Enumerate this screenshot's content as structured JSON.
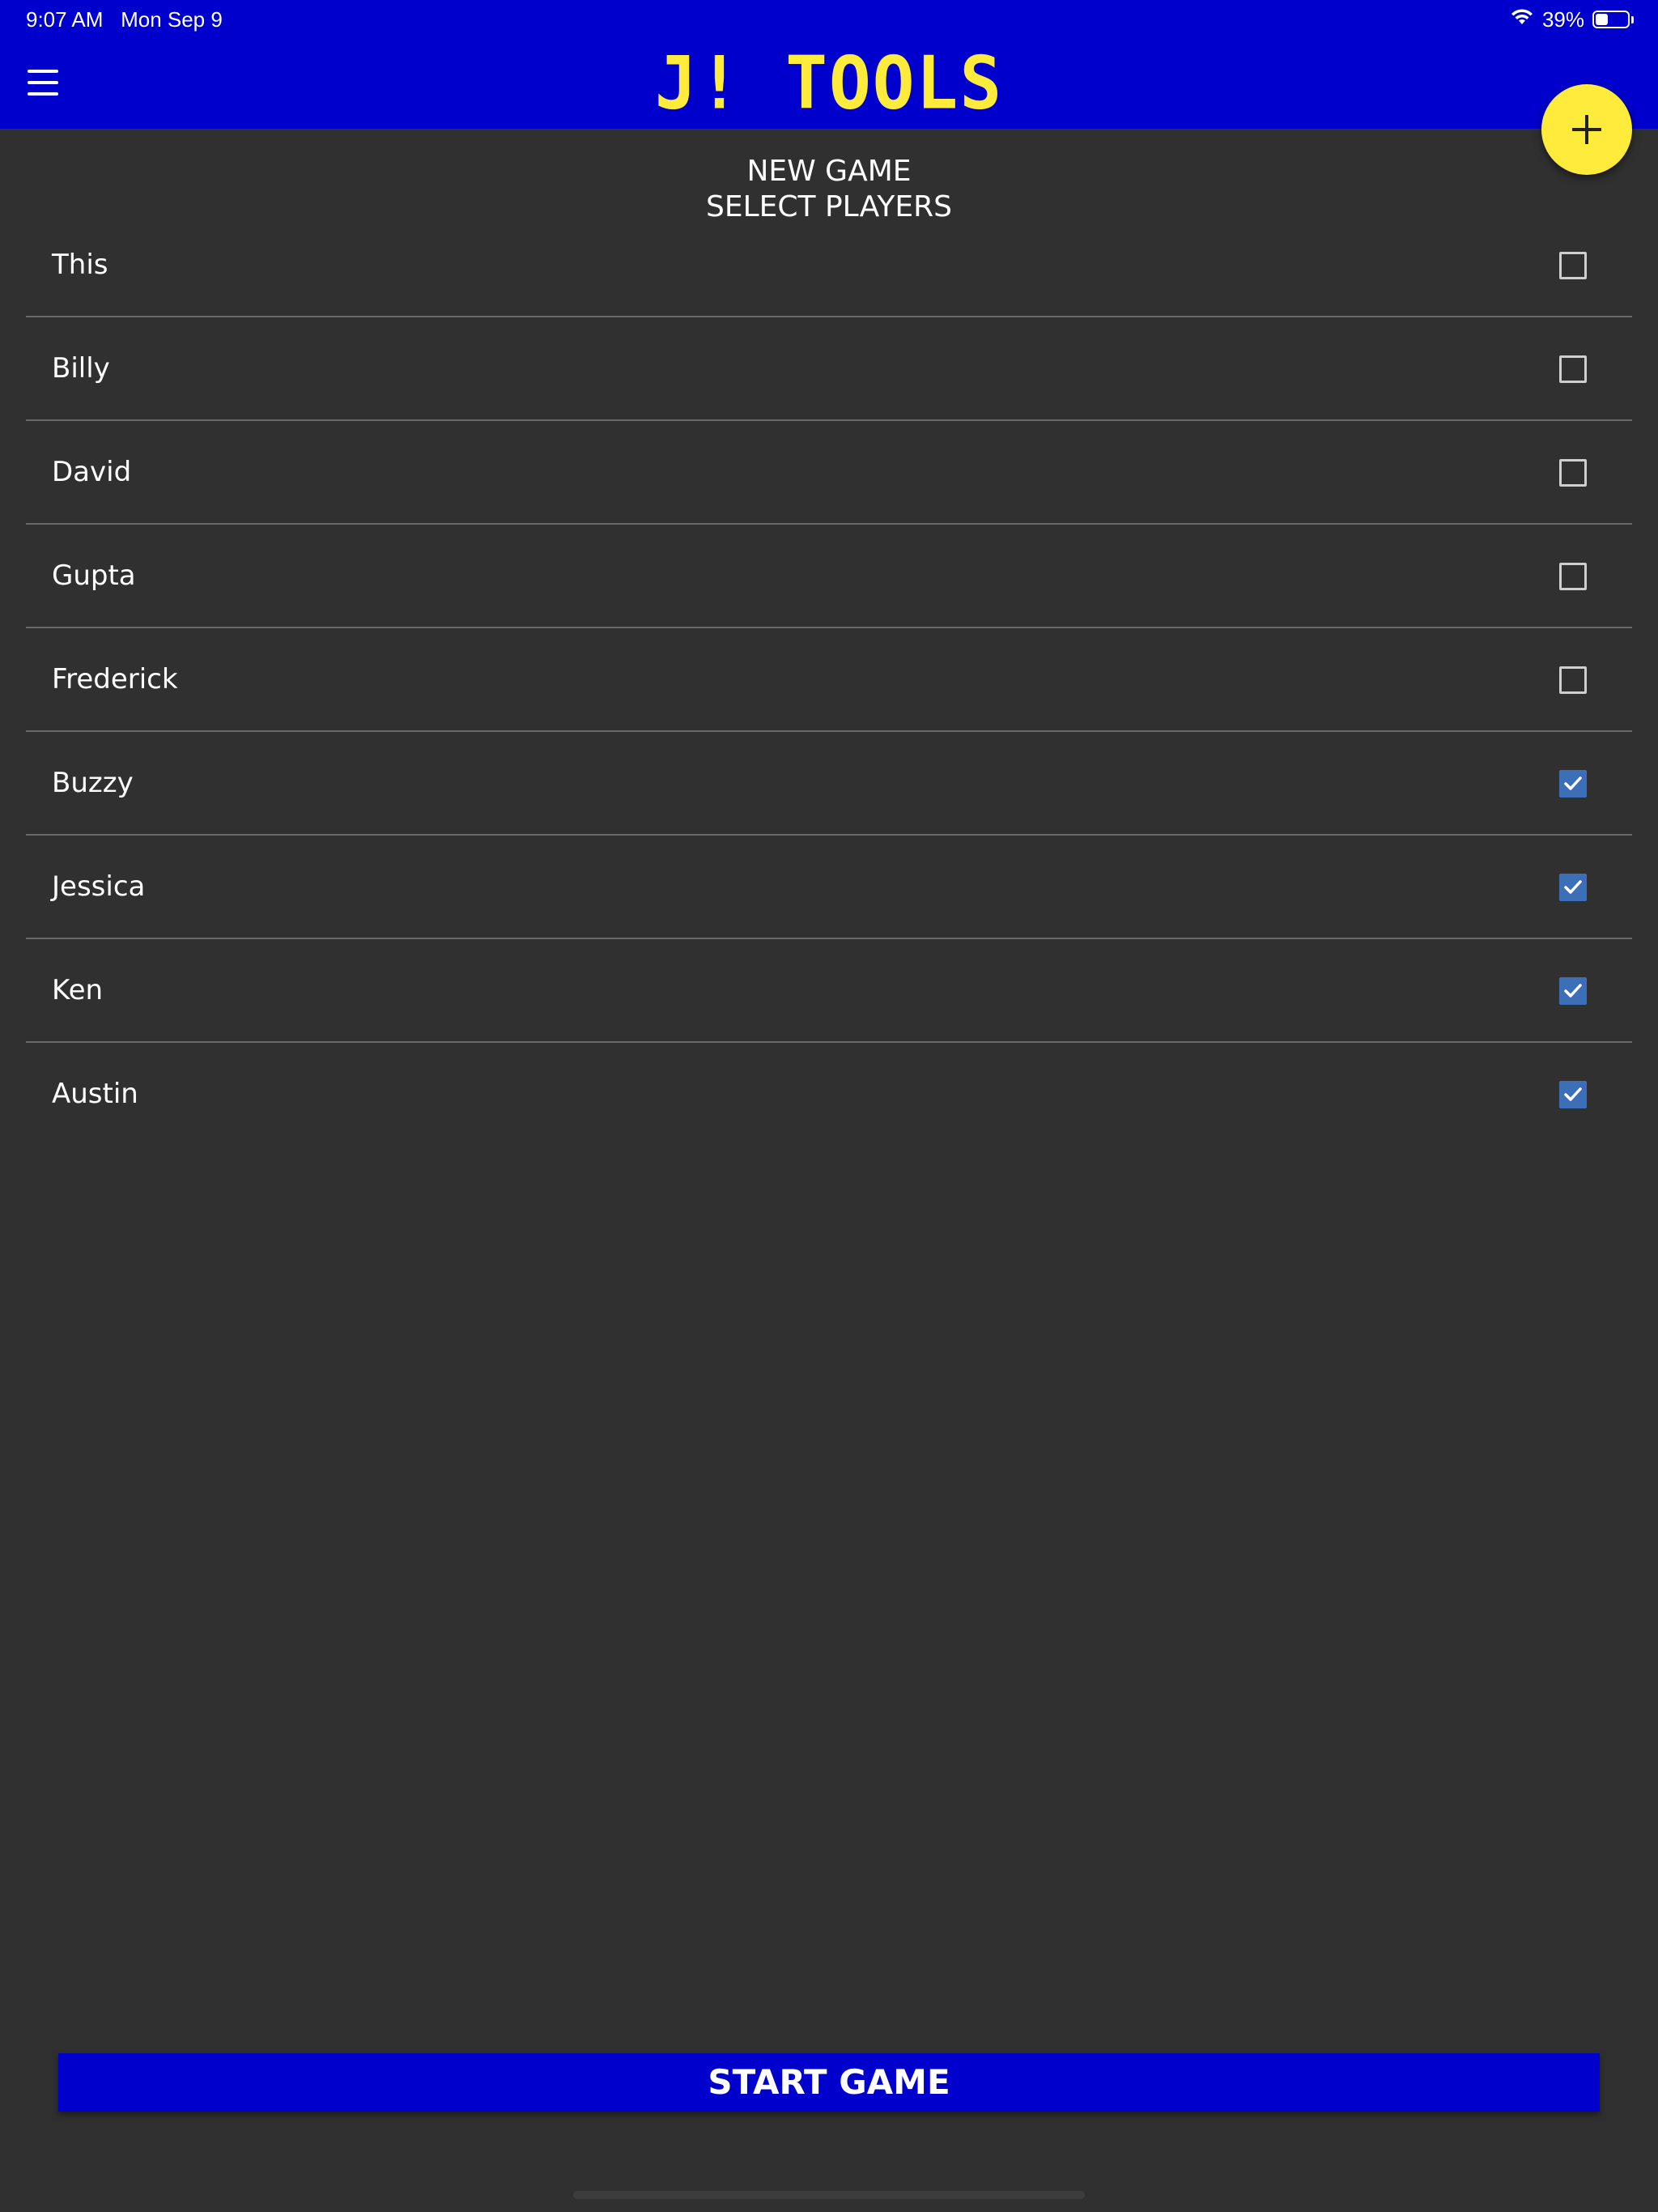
{
  "status_bar": {
    "time": "9:07 AM",
    "date": "Mon Sep 9",
    "battery_percent": "39%",
    "battery_level": 0.39,
    "wifi_icon": "wifi-icon",
    "battery_icon": "battery-icon"
  },
  "header": {
    "logo": "J! TOOLS",
    "menu_icon": "hamburger-menu-icon",
    "add_icon": "plus-icon"
  },
  "colors": {
    "header_bg": "#0000cc",
    "logo": "#ffeb3b",
    "fab": "#ffeb3b",
    "background": "#303030",
    "checkbox_checked": "#3d6fb8",
    "start_button": "#0000cc"
  },
  "page": {
    "title_line1": "NEW GAME",
    "title_line2": "SELECT PLAYERS"
  },
  "players": [
    {
      "name": "This",
      "selected": false
    },
    {
      "name": "Billy",
      "selected": false
    },
    {
      "name": "David",
      "selected": false
    },
    {
      "name": "Gupta",
      "selected": false
    },
    {
      "name": "Frederick",
      "selected": false
    },
    {
      "name": "Buzzy",
      "selected": true
    },
    {
      "name": "Jessica",
      "selected": true
    },
    {
      "name": "Ken",
      "selected": true
    },
    {
      "name": "Austin",
      "selected": true
    }
  ],
  "actions": {
    "start_label": "START GAME"
  }
}
